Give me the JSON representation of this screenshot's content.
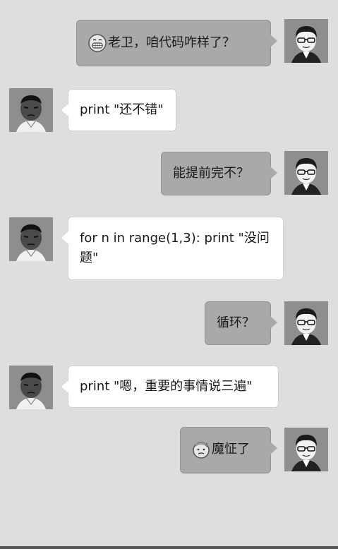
{
  "messages": [
    {
      "side": "me",
      "emoji": "grinning-face-icon",
      "text": "老卫，咱代码咋样了？"
    },
    {
      "side": "friend",
      "text": "print \"还不错\""
    },
    {
      "side": "me",
      "text": "能提前完不？"
    },
    {
      "side": "friend",
      "text": "for n in range(1,3): print \"没问题\""
    },
    {
      "side": "me",
      "text": "循环？"
    },
    {
      "side": "friend",
      "text": "print \"嗯，重要的事情说三遍\""
    },
    {
      "side": "me",
      "emoji": "cold-sweat-face-icon",
      "text": "魔怔了"
    }
  ],
  "colors": {
    "background": "#dedede",
    "outgoing_bubble": "#a9a9a9",
    "incoming_bubble": "#ffffff",
    "avatar_bg": "#8e8e8e"
  }
}
